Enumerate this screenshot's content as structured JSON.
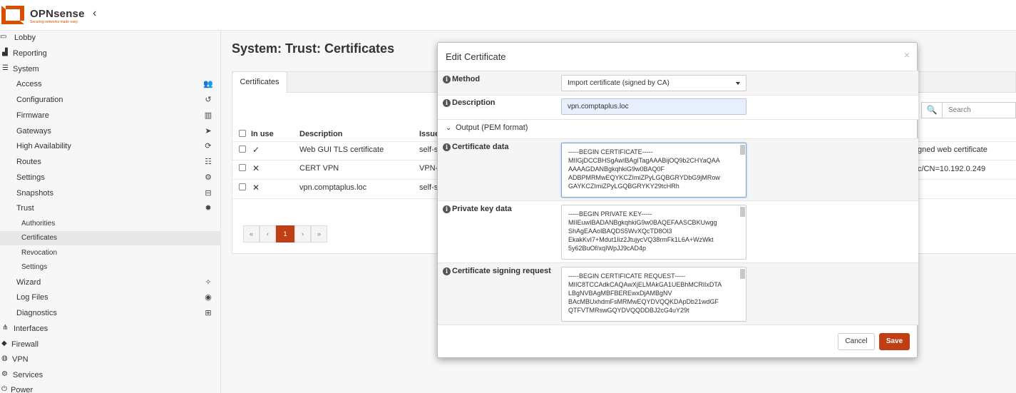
{
  "header": {
    "brand": "OPNsense",
    "tagline": "Securing networks made easy",
    "brand_color": "#d94f00"
  },
  "sidebar": {
    "items": [
      {
        "label": "Lobby",
        "icon": "laptop-icon"
      },
      {
        "label": "Reporting",
        "icon": "chart-icon"
      },
      {
        "label": "System",
        "icon": "server-icon"
      },
      {
        "label": "Access",
        "icon": "users-icon"
      },
      {
        "label": "Configuration",
        "icon": "history-icon"
      },
      {
        "label": "Firmware",
        "icon": "building-icon"
      },
      {
        "label": "Gateways",
        "icon": "location-arrow-icon"
      },
      {
        "label": "High Availability",
        "icon": "refresh-icon"
      },
      {
        "label": "Routes",
        "icon": "signpost-icon"
      },
      {
        "label": "Settings",
        "icon": "cogs-icon"
      },
      {
        "label": "Snapshots",
        "icon": "hdd-icon"
      },
      {
        "label": "Trust",
        "icon": "certificate-icon"
      },
      {
        "label": "Authorities"
      },
      {
        "label": "Certificates"
      },
      {
        "label": "Revocation"
      },
      {
        "label": "Settings"
      },
      {
        "label": "Wizard",
        "icon": "magic-icon"
      },
      {
        "label": "Log Files",
        "icon": "eye-icon"
      },
      {
        "label": "Diagnostics",
        "icon": "medkit-icon"
      },
      {
        "label": "Interfaces",
        "icon": "sitemap-icon"
      },
      {
        "label": "Firewall",
        "icon": "fire-icon"
      },
      {
        "label": "VPN",
        "icon": "globe-icon"
      },
      {
        "label": "Services",
        "icon": "cog-icon"
      },
      {
        "label": "Power",
        "icon": "plug-icon"
      }
    ]
  },
  "page": {
    "title": "System: Trust: Certificates",
    "tab": "Certificates",
    "search_placeholder": "Search"
  },
  "table": {
    "headers": [
      "In use",
      "Description",
      "Issuer"
    ],
    "rows": [
      {
        "in_use": "✓",
        "description": "Web GUI TLS certificate",
        "issuer": "self-s",
        "extra": "gned web certificate"
      },
      {
        "in_use": "✕",
        "description": "CERT VPN",
        "issuer": "VPN-C",
        "extra": "c/CN=10.192.0.249"
      },
      {
        "in_use": "✕",
        "description": "vpn.comptaplus.loc",
        "issuer": "self-s",
        "extra": ""
      }
    ]
  },
  "pager": {
    "first": "«",
    "prev": "‹",
    "current": "1",
    "next": "›",
    "last": "»"
  },
  "modal": {
    "title": "Edit Certificate",
    "close": "×",
    "method_label": "Method",
    "method_value": "Import certificate (signed by CA)",
    "description_label": "Description",
    "description_value": "vpn.comptaplus.loc",
    "section_label": "Output (PEM format)",
    "cert_label": "Certificate data",
    "cert_value": "-----BEGIN CERTIFICATE-----\nMIIGjDCCBHSgAwIBAgITagAAABijOQ9b2CHYaQAA\nAAAAGDANBgkqhkiG9w0BAQ0F\nADBPMRMwEQYKCZImiZPyLGQBGRYDbG9jMRow\nGAYKCZImiZPyLGQBGRYKY29tcHRh",
    "key_label": "Private key data",
    "key_value": "-----BEGIN PRIVATE KEY-----\nMIIEuwIBADANBgkqhkiG9w0BAQEFAASCBKUwgg\nShAgEAAoIBAQDS5WvXQcTD8Ol3\nEkakKvI7+Mdut1Iiz2JtujycVQ38rmFk1L6A+WzWkt\n5y62BuOf/xqIWpJJ9cAD4p",
    "csr_label": "Certificate signing request",
    "csr_value": "-----BEGIN CERTIFICATE REQUEST-----\nMIIC8TCCAdkCAQAwXjELMAkGA1UEBhMCRlIxDTA\nLBgNVBAgMBFBEREwxDjAMBgNV\nBAcMBUxhdmFsMRMwEQYDVQQKDApDb21wdGF\nQTFVTMRswGQYDVQQDDBJ2cG4uY29t",
    "cancel": "Cancel",
    "save": "Save",
    "accent": "#c03e14"
  }
}
